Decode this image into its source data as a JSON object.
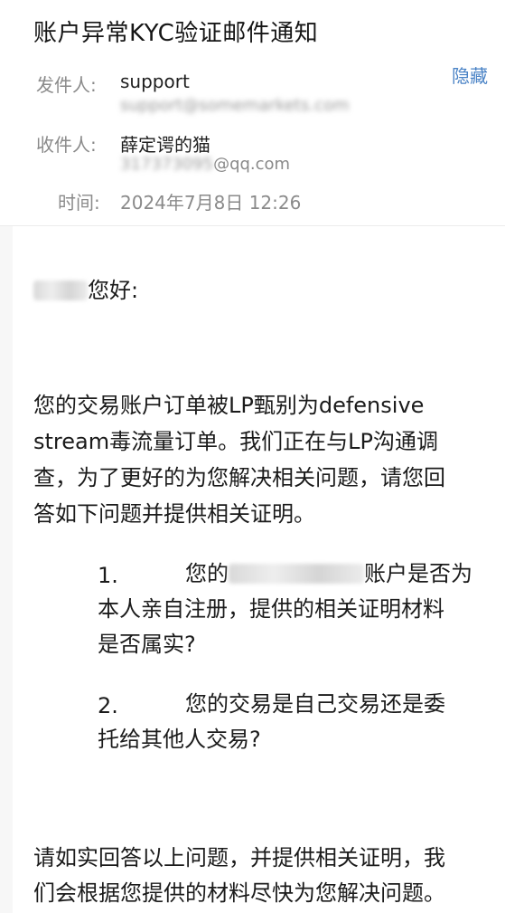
{
  "email": {
    "subject": "账户异常KYC验证邮件通知",
    "hide_label": "隐藏",
    "from_label": "发件人:",
    "from_name": "support",
    "from_address": "support@somemarkets.com",
    "to_label": "收件人:",
    "to_name": "薛定谔的猫",
    "to_address_blurred": "317373095",
    "to_address_domain": "@qq.com",
    "time_label": "时间:",
    "time_value": "2024年7月8日 12:26"
  },
  "body": {
    "greeting_suffix": "您好:",
    "para1_lines": [
      "您的交易账户订单被LP甄别为defensive",
      "stream毒流量订单。我们正在与LP沟通调",
      "查，为了更好的为您解决相关问题，请您回",
      "答如下问题并提供相关证明。"
    ],
    "q1_num": "1.",
    "q1_prefix": "您的",
    "q1_suffix": "账户是否为",
    "q1_line2": "本人亲自注册，提供的相关证明材料",
    "q1_line3": "是否属实?",
    "q2_num": "2.",
    "q2_line1": "您的交易是自己交易还是委",
    "q2_line2": "托给其他人交易?",
    "closing_lines": [
      "请如实回答以上问题，并提供相关证明，我",
      "们会根据您提供的材料尽快为您解决问题。"
    ]
  }
}
